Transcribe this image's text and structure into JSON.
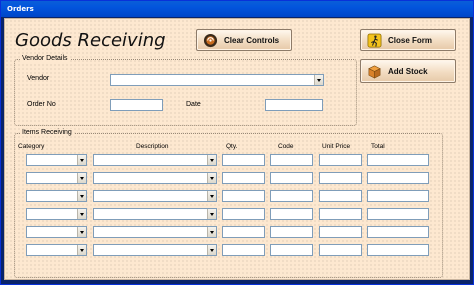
{
  "window": {
    "title": "Orders"
  },
  "header": {
    "title": "Goods Receiving"
  },
  "buttons": {
    "clear_controls": "Clear Controls",
    "close_form": "Close Form",
    "add_stock": "Add Stock"
  },
  "vendor_details": {
    "label": "Vendor Details",
    "vendor_label": "Vendor",
    "vendor_value": "",
    "order_no_label": "Order No",
    "order_no_value": "",
    "date_label": "Date",
    "date_value": ""
  },
  "items_receiving": {
    "label": "Items Receiving",
    "columns": [
      "Category",
      "Description",
      "Qty.",
      "Code",
      "Unit Price",
      "Total"
    ],
    "rows": [
      {
        "category": "",
        "description": "",
        "qty": "",
        "code": "",
        "unit_price": "",
        "total": ""
      },
      {
        "category": "",
        "description": "",
        "qty": "",
        "code": "",
        "unit_price": "",
        "total": ""
      },
      {
        "category": "",
        "description": "",
        "qty": "",
        "code": "",
        "unit_price": "",
        "total": ""
      },
      {
        "category": "",
        "description": "",
        "qty": "",
        "code": "",
        "unit_price": "",
        "total": ""
      },
      {
        "category": "",
        "description": "",
        "qty": "",
        "code": "",
        "unit_price": "",
        "total": ""
      },
      {
        "category": "",
        "description": "",
        "qty": "",
        "code": "",
        "unit_price": "",
        "total": ""
      }
    ]
  },
  "icons": {
    "clear_controls": "clear-disc-icon",
    "close_form": "exit-icon",
    "add_stock": "box-icon"
  },
  "colors": {
    "form_background": "#fde8d0",
    "titlebar": "#0254dd",
    "button_face": "#f2dcc2"
  }
}
